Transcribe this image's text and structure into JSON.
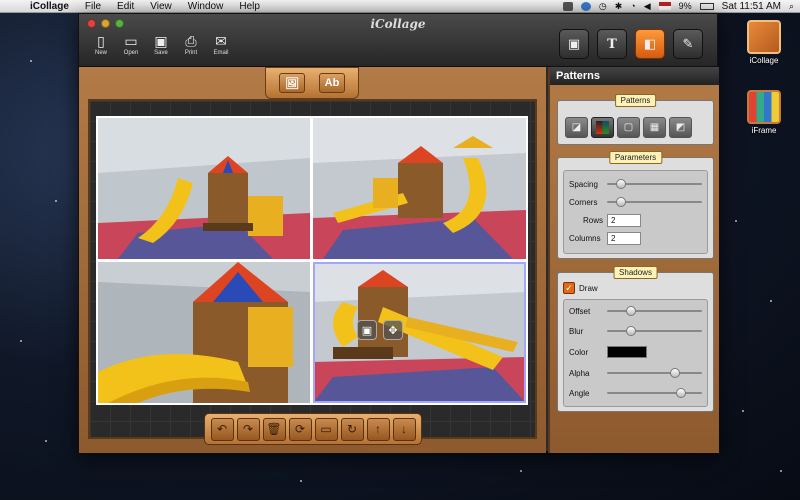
{
  "menubar": {
    "app_name": "iCollage",
    "items": [
      "File",
      "Edit",
      "View",
      "Window",
      "Help"
    ],
    "battery": "9%",
    "clock": "Sat 11:51 AM"
  },
  "window": {
    "title": "iCollage",
    "toolbar": [
      {
        "label": "New",
        "icon": "new-document-icon"
      },
      {
        "label": "Open",
        "icon": "folder-icon"
      },
      {
        "label": "Save",
        "icon": "save-icon"
      },
      {
        "label": "Print",
        "icon": "printer-icon"
      },
      {
        "label": "Email",
        "icon": "envelope-icon"
      }
    ],
    "mode_tabs": [
      {
        "icon": "image-mode-icon",
        "glyph": "▣",
        "active": false
      },
      {
        "icon": "text-mode-icon",
        "glyph": "T",
        "active": false
      },
      {
        "icon": "layout-mode-icon",
        "glyph": "◧",
        "active": true
      },
      {
        "icon": "tools-mode-icon",
        "glyph": "✎",
        "active": false
      }
    ]
  },
  "canvas": {
    "add_buttons": [
      {
        "icon": "add-image-icon",
        "glyph": "🖼"
      },
      {
        "icon": "add-text-icon",
        "glyph": "Ab"
      }
    ],
    "bottom_tools": [
      {
        "icon": "undo-icon",
        "glyph": "↶"
      },
      {
        "icon": "redo-icon",
        "glyph": "↷"
      },
      {
        "icon": "trash-icon",
        "glyph": "🗑"
      },
      {
        "icon": "refresh-icon",
        "glyph": "⟳"
      },
      {
        "icon": "fit-icon",
        "glyph": "▭"
      },
      {
        "icon": "rotate-icon",
        "glyph": "↻"
      },
      {
        "icon": "bring-forward-icon",
        "glyph": "↑"
      },
      {
        "icon": "send-backward-icon",
        "glyph": "↓"
      }
    ]
  },
  "panel": {
    "title": "Patterns",
    "patterns_label": "Patterns",
    "parameters_label": "Parameters",
    "spacing_label": "Spacing",
    "spacing_value": 0.15,
    "corners_label": "Corners",
    "corners_value": 0.15,
    "rows_label": "Rows",
    "rows_value": "2",
    "columns_label": "Columns",
    "columns_value": "2",
    "shadows_label": "Shadows",
    "draw_label": "Draw",
    "offset_label": "Offset",
    "offset_value": 0.25,
    "blur_label": "Blur",
    "blur_value": 0.25,
    "color_label": "Color",
    "shadow_color": "#000000",
    "alpha_label": "Alpha",
    "alpha_value": 0.72,
    "angle_label": "Angle",
    "angle_value": 0.78
  },
  "desktop": {
    "icons": [
      {
        "label": "iCollage"
      },
      {
        "label": "iFrame"
      }
    ]
  },
  "colors": {
    "accent_orange": "#e06a1a",
    "wood": "#b27a46"
  }
}
